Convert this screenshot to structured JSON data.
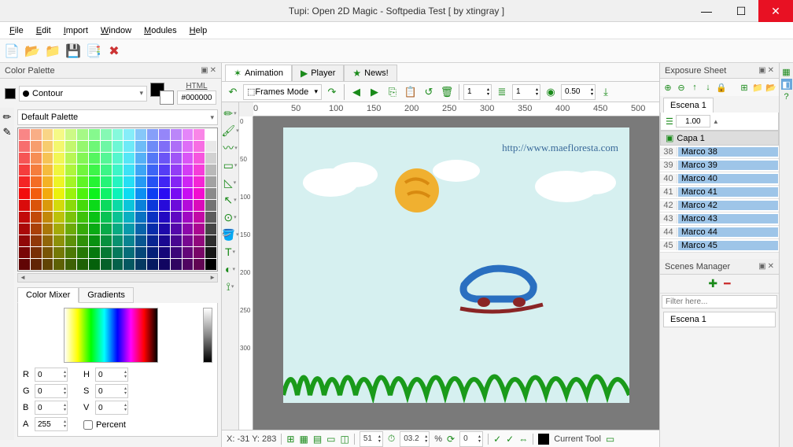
{
  "title": "Tupi: Open 2D Magic - Softpedia Test [ by xtingray ]",
  "menu": [
    "File",
    "Edit",
    "Import",
    "Window",
    "Modules",
    "Help"
  ],
  "colorPalette": {
    "title": "Color Palette",
    "mode": "Contour",
    "htmlLabel": "HTML",
    "htmlValue": "#000000",
    "paletteName": "Default Palette"
  },
  "colorMixer": {
    "tabs": [
      "Color Mixer",
      "Gradients"
    ],
    "r": "0",
    "g": "0",
    "b": "0",
    "a": "255",
    "h": "0",
    "s": "0",
    "v": "0",
    "percentLabel": "Percent"
  },
  "centerTabs": [
    {
      "label": "Animation",
      "icon": "✶"
    },
    {
      "label": "Player",
      "icon": "▶"
    },
    {
      "label": "News!",
      "icon": "★"
    }
  ],
  "framesMode": "Frames Mode",
  "toolbarSpin1": "1",
  "toolbarSpin2": "1",
  "toolbarSpin3": "0.50",
  "rulerH": [
    "0",
    "50",
    "100",
    "150",
    "200",
    "250",
    "300",
    "350",
    "400",
    "450",
    "500"
  ],
  "rulerV": [
    "0",
    "50",
    "100",
    "150",
    "200",
    "250",
    "300"
  ],
  "canvasWatermark": "http://www.maefloresta.com",
  "status": {
    "coords": "X: -31 Y: 283",
    "fps": "51",
    "zoom": "03.2",
    "pct": "%",
    "rot": "0",
    "toolLabel": "Current Tool"
  },
  "exposure": {
    "title": "Exposure Sheet",
    "scene": "Escena 1",
    "opacity": "1.00",
    "layer": "Capa 1",
    "frames": [
      {
        "n": "38",
        "name": "Marco 38"
      },
      {
        "n": "39",
        "name": "Marco 39"
      },
      {
        "n": "40",
        "name": "Marco 40"
      },
      {
        "n": "41",
        "name": "Marco 41"
      },
      {
        "n": "42",
        "name": "Marco 42"
      },
      {
        "n": "43",
        "name": "Marco 43"
      },
      {
        "n": "44",
        "name": "Marco 44"
      },
      {
        "n": "45",
        "name": "Marco 45"
      }
    ]
  },
  "scenesManager": {
    "title": "Scenes Manager",
    "filterPlaceholder": "Filter here...",
    "scene": "Escena 1"
  }
}
